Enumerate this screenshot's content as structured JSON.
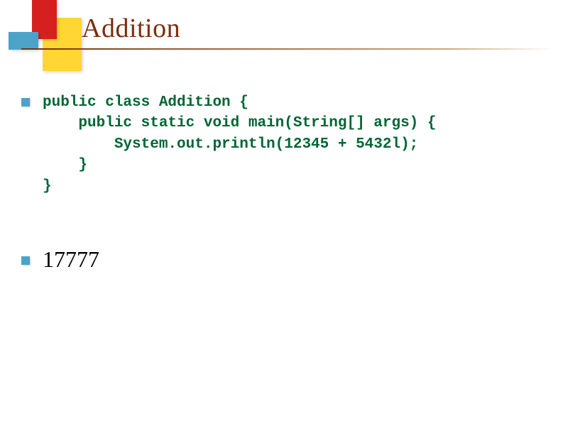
{
  "title": "Addition",
  "code": {
    "line1": "public class Addition {",
    "line2": "    public static void main(String[] args) {",
    "line3": "        System.out.println(12345 + 5432l);",
    "line4": "    }",
    "line5": "}"
  },
  "output": "17777"
}
